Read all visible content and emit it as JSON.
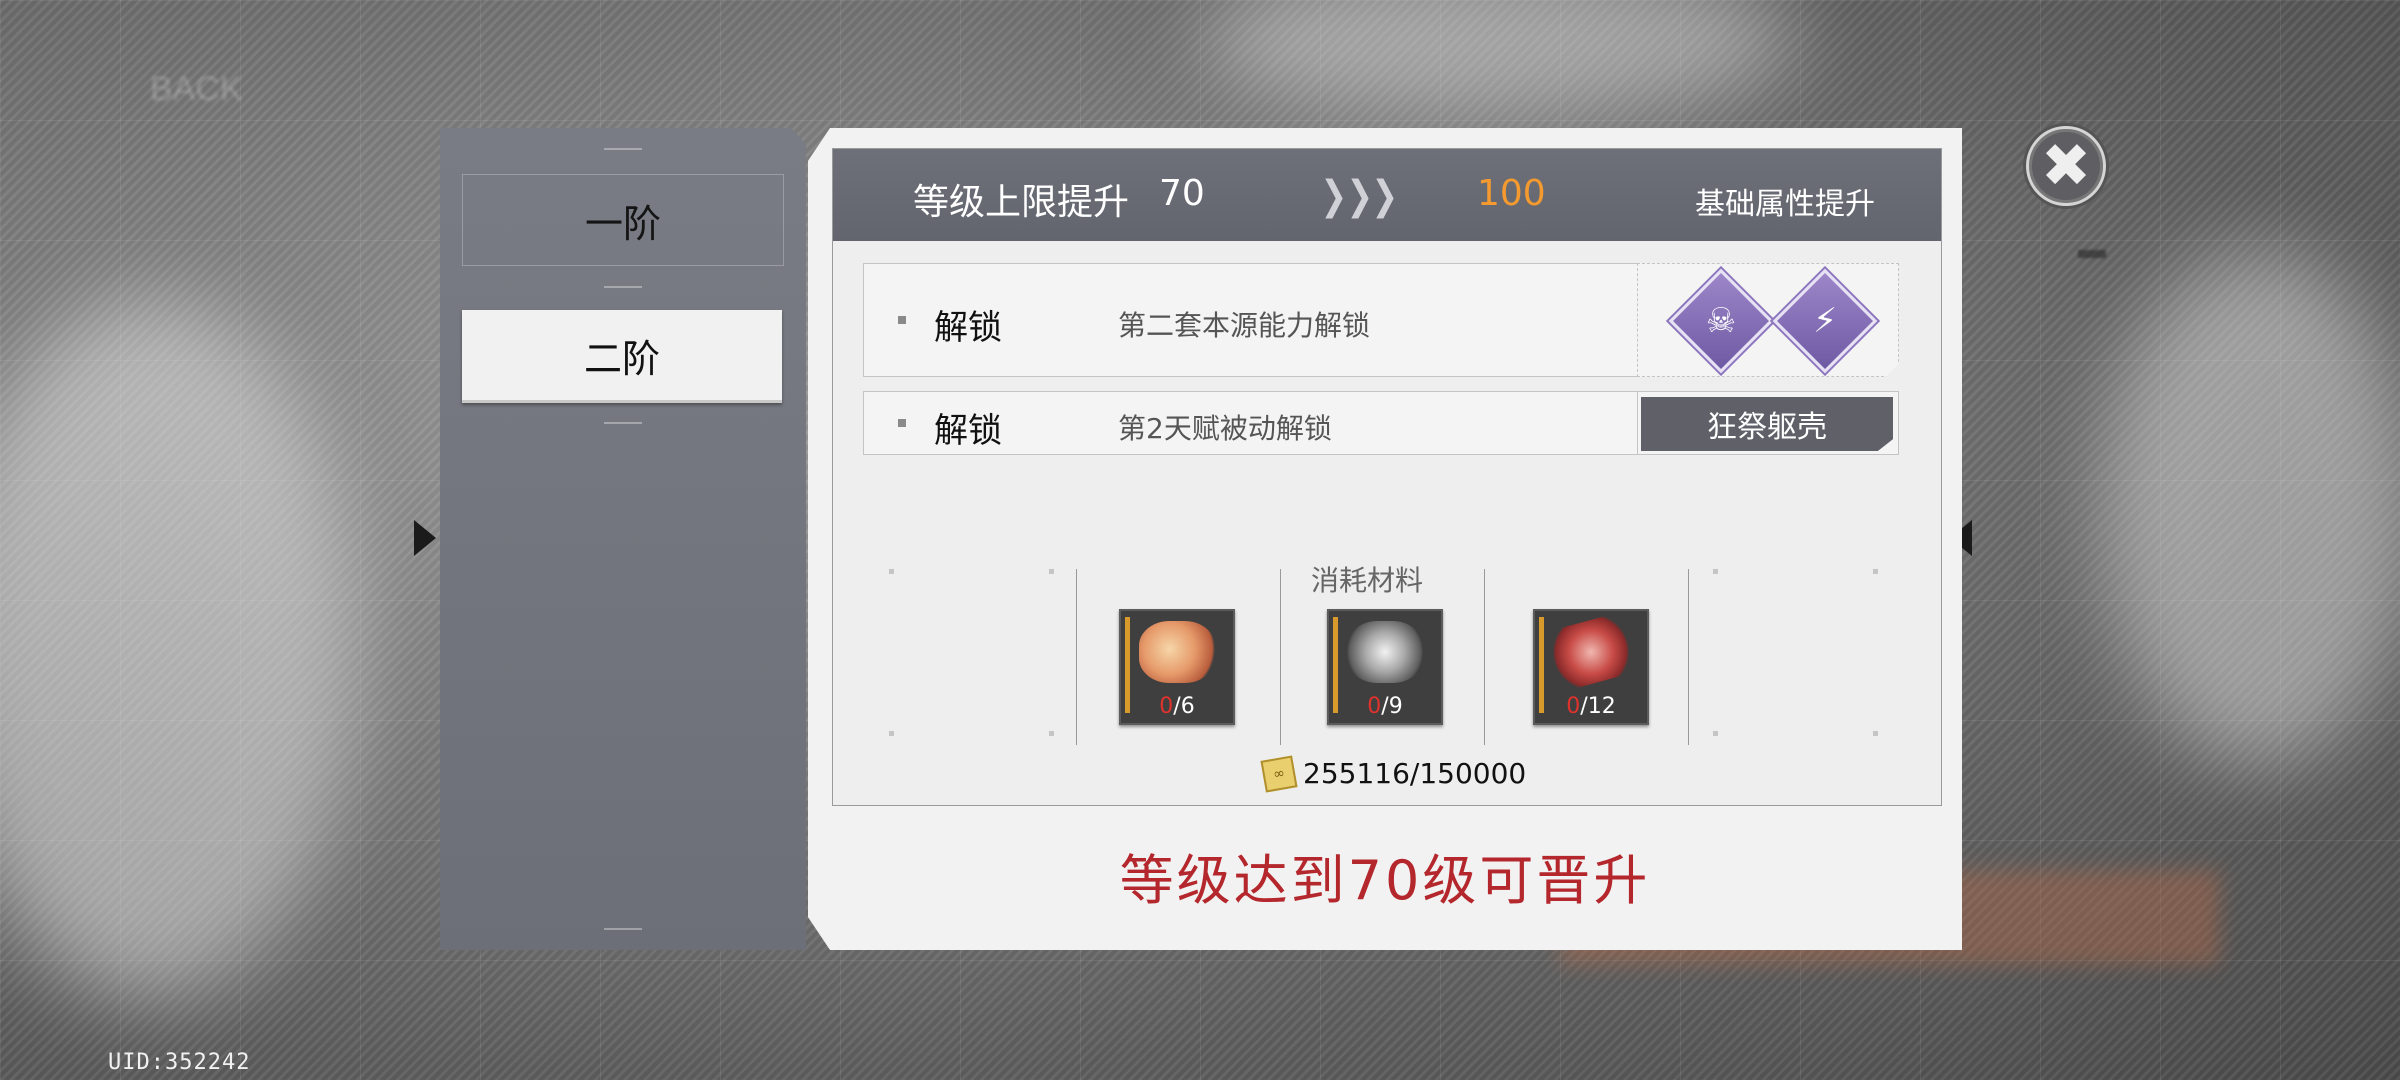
{
  "uid": "UID:352242",
  "tiers": [
    {
      "label": "一阶",
      "active": false
    },
    {
      "label": "二阶",
      "active": true
    }
  ],
  "header": {
    "label": "等级上限提升",
    "from_level": "70",
    "to_level": "100",
    "attribute": "基础属性提升"
  },
  "unlocks": [
    {
      "label": "解锁",
      "desc": "第二套本源能力解锁",
      "icons": [
        "wolf-skill-icon",
        "lightning-skill-icon"
      ]
    },
    {
      "label": "解锁",
      "desc": "第2天赋被动解锁",
      "talent": "狂祭躯壳"
    }
  ],
  "materials": {
    "title": "消耗材料",
    "items": [
      {
        "have": "0",
        "need": "/6",
        "icon": "flower-material-icon"
      },
      {
        "have": "0",
        "need": "/9",
        "icon": "ore-material-icon"
      },
      {
        "have": "0",
        "need": "/12",
        "icon": "card-material-icon"
      }
    ]
  },
  "currency": {
    "value": "255116/150000",
    "icon": "coin-icon"
  },
  "requirement": "等级达到70级可晋升",
  "colors": {
    "accent_orange": "#f59a2e",
    "requirement_red": "#b4272c",
    "skill_purple": "#8c76bd"
  }
}
